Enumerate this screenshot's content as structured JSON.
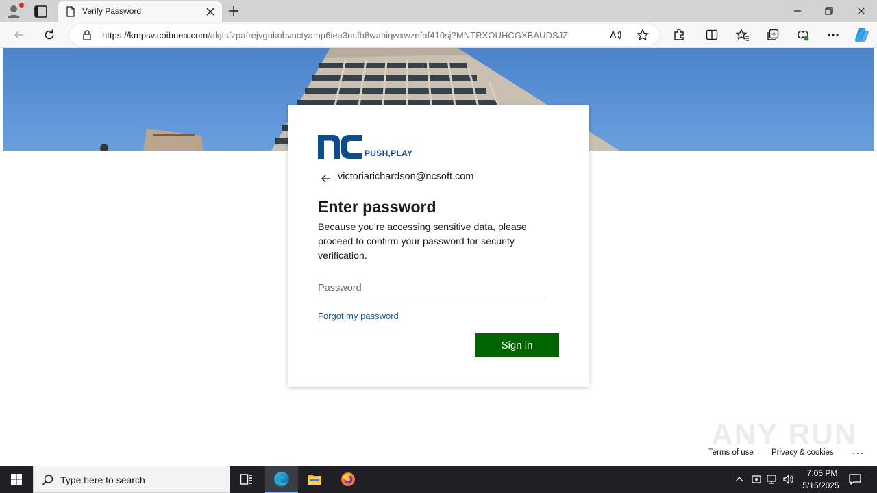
{
  "browser": {
    "tab_title": "Verify Password",
    "url_host": "https://kmpsv.coibnea.com",
    "url_path": "/akjtsfzpafrejvgokobvnctyamp6iea3nsfb8wahiqwxwzefaf410sj?MNTRXOUHCGXBAUDSJZ"
  },
  "login": {
    "brand_tagline": "PUSH,PLAY",
    "email": "victoriarichardson@ncsoft.com",
    "title": "Enter password",
    "description": "Because you're accessing sensitive data, please proceed to confirm your password for security verification.",
    "password_placeholder": "Password",
    "password_value": "",
    "forgot_link": "Forgot my password",
    "signin_label": "Sign in"
  },
  "footer": {
    "terms": "Terms of use",
    "privacy": "Privacy & cookies",
    "more": "..."
  },
  "watermark": "ANY RUN",
  "taskbar": {
    "search_placeholder": "Type here to search",
    "time": "7:05 PM",
    "date": "5/15/2025"
  },
  "colors": {
    "signin_bg": "#006400",
    "link": "#0f6198",
    "brand": "#0f4c8a"
  }
}
